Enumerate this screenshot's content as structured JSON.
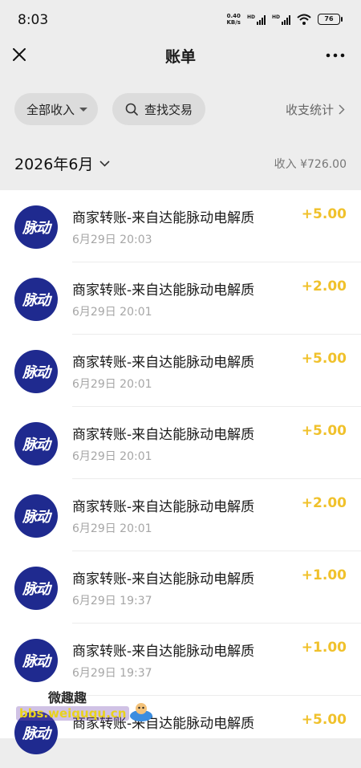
{
  "status_bar": {
    "time": "8:03",
    "net_speed_value": "0.40",
    "net_speed_unit": "KB/s",
    "signal_badge": "HD",
    "battery": "76"
  },
  "header": {
    "title": "账单"
  },
  "filters": {
    "all_income_label": "全部收入",
    "search_label": "查找交易",
    "stats_label": "收支统计"
  },
  "month": {
    "label": "2026年6月",
    "income_summary": "收入 ¥726.00"
  },
  "transactions": [
    {
      "logo_text": "脉动",
      "title": "商家转账-来自达能脉动电解质",
      "time": "6月29日 20:03",
      "amount": "+5.00"
    },
    {
      "logo_text": "脉动",
      "title": "商家转账-来自达能脉动电解质",
      "time": "6月29日 20:01",
      "amount": "+2.00"
    },
    {
      "logo_text": "脉动",
      "title": "商家转账-来自达能脉动电解质",
      "time": "6月29日 20:01",
      "amount": "+5.00"
    },
    {
      "logo_text": "脉动",
      "title": "商家转账-来自达能脉动电解质",
      "time": "6月29日 20:01",
      "amount": "+5.00"
    },
    {
      "logo_text": "脉动",
      "title": "商家转账-来自达能脉动电解质",
      "time": "6月29日 20:01",
      "amount": "+2.00"
    },
    {
      "logo_text": "脉动",
      "title": "商家转账-来自达能脉动电解质",
      "time": "6月29日 19:37",
      "amount": "+1.00"
    },
    {
      "logo_text": "脉动",
      "title": "商家转账-来自达能脉动电解质",
      "time": "6月29日 19:37",
      "amount": "+1.00"
    },
    {
      "logo_text": "脉动",
      "title": "商家转账-来自达能脉动电解质",
      "time": "",
      "amount": "+5.00"
    }
  ],
  "watermark": {
    "top_text": "微趣趣",
    "bottom_text": "bbs.weiququ.cn"
  },
  "colors": {
    "amount": "#f0c12b",
    "logo_bg": "#1f2a8f",
    "page_bg": "#ededed"
  },
  "icons": {
    "close": "close-icon",
    "more": "more-icon",
    "search": "search-icon",
    "chevron_right": "chevron-right-icon",
    "chevron_down": "chevron-down-icon"
  }
}
